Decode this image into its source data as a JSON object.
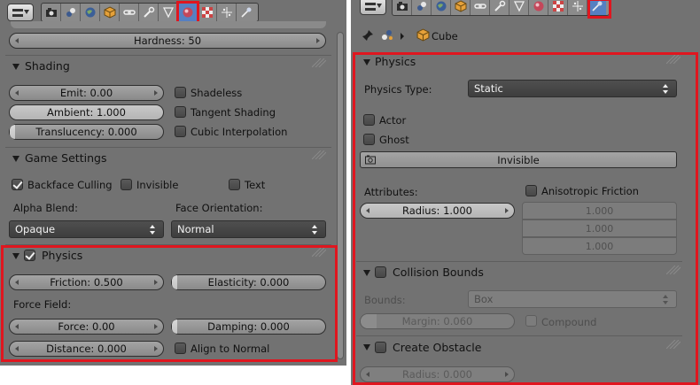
{
  "left": {
    "hardness": "Hardness: 50",
    "shading": {
      "header": "Shading",
      "emit": "Emit: 0.00",
      "ambient": "Ambient: 1.000",
      "translucency": "Translucency: 0.000",
      "shadeless": "Shadeless",
      "tangent_shading": "Tangent Shading",
      "cubic_interpolation": "Cubic Interpolation"
    },
    "game_settings": {
      "header": "Game Settings",
      "backface_culling": "Backface Culling",
      "invisible": "Invisible",
      "text": "Text",
      "alpha_blend_label": "Alpha Blend:",
      "alpha_blend_value": "Opaque",
      "face_orientation_label": "Face Orientation:",
      "face_orientation_value": "Normal"
    },
    "physics": {
      "header": "Physics",
      "friction": "Friction: 0.500",
      "elasticity": "Elasticity: 0.000",
      "force_field_label": "Force Field:",
      "force": "Force: 0.00",
      "damping": "Damping: 0.000",
      "distance": "Distance: 0.000",
      "align_to_normal": "Align to Normal"
    }
  },
  "right": {
    "breadcrumb_object": "Cube",
    "physics": {
      "header": "Physics",
      "type_label": "Physics Type:",
      "type_value": "Static",
      "actor": "Actor",
      "ghost": "Ghost",
      "invisible_button": "Invisible",
      "attributes_label": "Attributes:",
      "radius": "Radius: 1.000",
      "anisotropic_friction": "Anisotropic Friction",
      "aniso_values": [
        "1.000",
        "1.000",
        "1.000"
      ]
    },
    "collision_bounds": {
      "header": "Collision Bounds",
      "bounds_label": "Bounds:",
      "bounds_value": "Box",
      "margin": "Margin: 0.060",
      "compound": "Compound"
    },
    "create_obstacle": {
      "header": "Create Obstacle",
      "radius": "Radius: 0.000"
    }
  },
  "colors": {
    "panel_bg": "#727272",
    "highlight": "#e0161f",
    "active_tab": "#5680c2",
    "dropdown_bg": "#464646"
  },
  "icons": {
    "left_tabs": [
      "camera-icon",
      "render-layers-icon",
      "world-icon",
      "object-icon",
      "constraints-icon",
      "modifiers-icon",
      "mesh-data-icon",
      "material-icon",
      "texture-icon",
      "particles-icon",
      "physics-icon"
    ],
    "right_tabs": [
      "camera-icon",
      "render-layers-icon",
      "world-icon",
      "object-icon",
      "constraints-icon",
      "modifiers-icon",
      "mesh-data-icon",
      "material-icon",
      "texture-icon",
      "particles-icon",
      "physics-icon"
    ]
  },
  "ui_state": {
    "translucency_fill": 0.02,
    "elasticity_fill": 0.02,
    "damping_fill": 0.02,
    "margin_fill": 0.1
  }
}
